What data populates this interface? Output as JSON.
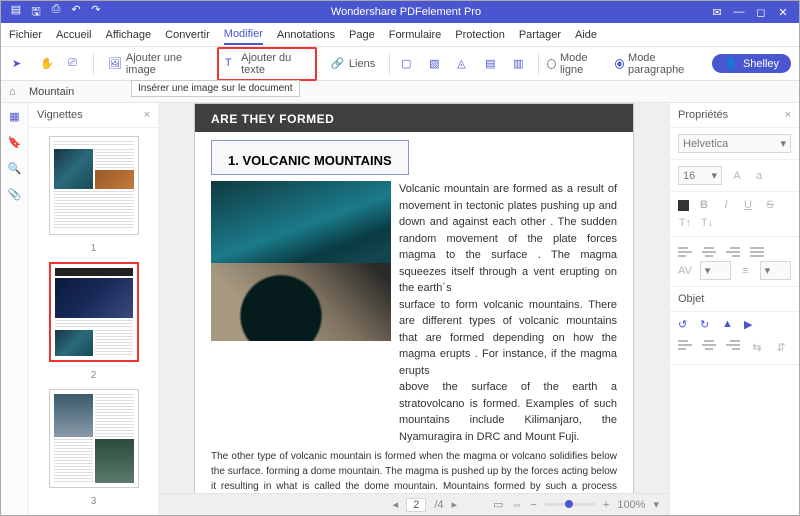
{
  "app": {
    "title": "Wondershare PDFelement Pro"
  },
  "menu": {
    "file": "Fichier",
    "home": "Accueil",
    "view": "Affichage",
    "convert": "Convertir",
    "edit": "Modifier",
    "annot": "Annotations",
    "page": "Page",
    "form": "Formulaire",
    "protect": "Protection",
    "share": "Partager",
    "help": "Aide"
  },
  "toolbar": {
    "addImage": "Ajouter une image",
    "addText": "Ajouter du texte",
    "links": "Liens",
    "modeLine": "Mode ligne",
    "modePara": "Mode paragraphe",
    "user": "Shelley",
    "tooltip": "Insérer une image sur le document"
  },
  "tabs": {
    "doc": "Mountain"
  },
  "panels": {
    "thumbs": "Vignettes",
    "props": "Propriétés",
    "object": "Objet"
  },
  "thumbs": {
    "n1": "1",
    "n2": "2",
    "n3": "3"
  },
  "doc": {
    "heroTail": "ARE THEY FORMED",
    "h1": "1. VOLCANIC MOUNTAINS",
    "p1": "Volcanic mountain are formed as a result of movement in tectonic plates pushing up and down and against each other . The sudden random movement  of the plate forces magma  to the surface . The magma squeezes itself through a vent erupting on the earth´s",
    "p2": "surface to form volcanic mountains. There are different types of volcanic mountains that are formed depending  on how the magma erupts . For instance, if the magma erupts",
    "p3": "above the surface of the earth a stratovolcano is formed. Examples of such mountains include Kilimanjaro, the Nyamuragira in DRC and Mount Fuji.",
    "p4": "The other type of volcanic mountain is formed when the magma or volcano solidifies below the surface. forming a dome mountain. The magma is pushed up by the forces acting below it resulting in what is called the dome mountain. Mountains formed by such a process include Torfajokull in Iceland and Navajo Mountain in Utah."
  },
  "props": {
    "font": "Helvetica",
    "size": "16"
  },
  "status": {
    "page": "2",
    "pages": "/4",
    "zoom": "100%"
  }
}
